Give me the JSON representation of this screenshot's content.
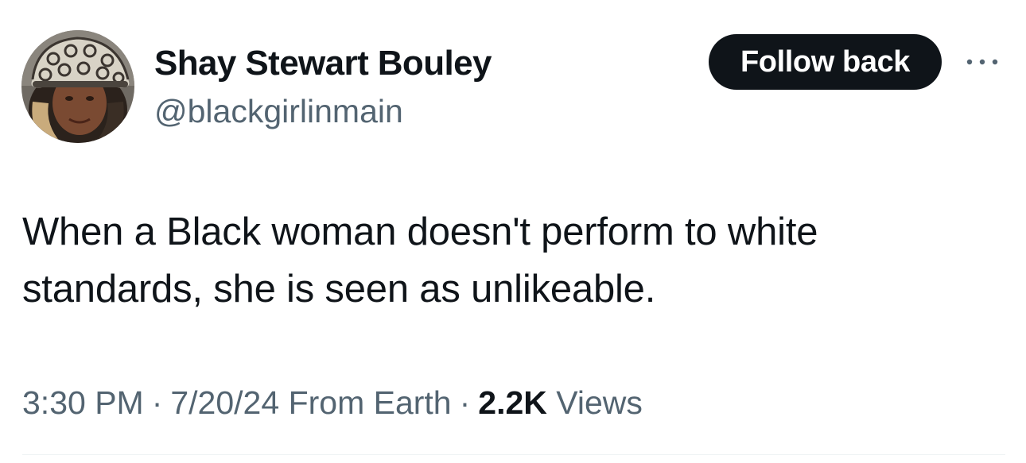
{
  "author": {
    "display_name": "Shay Stewart Bouley",
    "handle": "@blackgirlinmain"
  },
  "actions": {
    "follow_label": "Follow back",
    "more_icon": "more-horizontal-icon"
  },
  "tweet": {
    "text": "When a Black woman doesn't perform to white standards, she is seen as unlikeable."
  },
  "meta": {
    "time": "3:30 PM",
    "date": "7/20/24",
    "source": "From Earth",
    "separator": "·",
    "views_count": "2.2K",
    "views_label": "Views"
  },
  "colors": {
    "text_primary": "#0f1419",
    "text_secondary": "#536471",
    "button_bg": "#0f1419",
    "divider": "#eff3f4"
  }
}
